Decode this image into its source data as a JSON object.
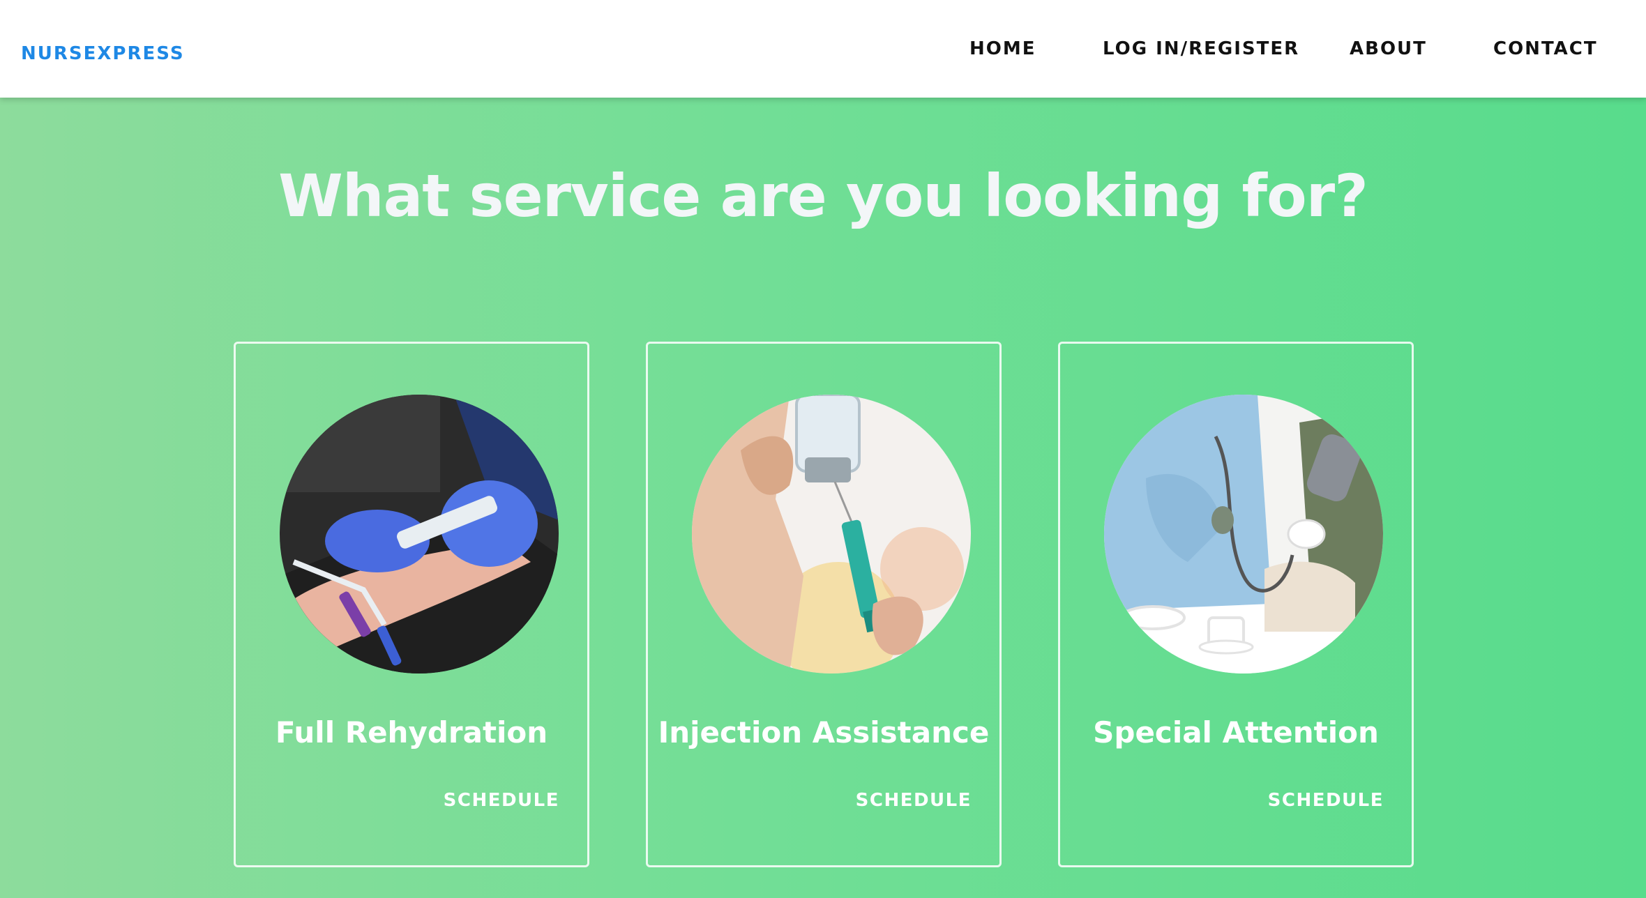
{
  "nav": {
    "brand": "NURSEXPRESS",
    "links": [
      "HOME",
      "LOG IN/REGISTER",
      "ABOUT",
      "CONTACT"
    ]
  },
  "hero": {
    "headline": "What service are you looking for?"
  },
  "services": [
    {
      "title": "Full Rehydration",
      "action": "SCHEDULE"
    },
    {
      "title": "Injection Assistance",
      "action": "SCHEDULE"
    },
    {
      "title": "Special Attention",
      "action": "SCHEDULE"
    }
  ],
  "colors": {
    "brand": "#1e88e5",
    "header_bg": "#ffffff",
    "gradient_start": "#8ddc9c",
    "gradient_end": "#58dc8c",
    "card_text": "#ffffff"
  }
}
